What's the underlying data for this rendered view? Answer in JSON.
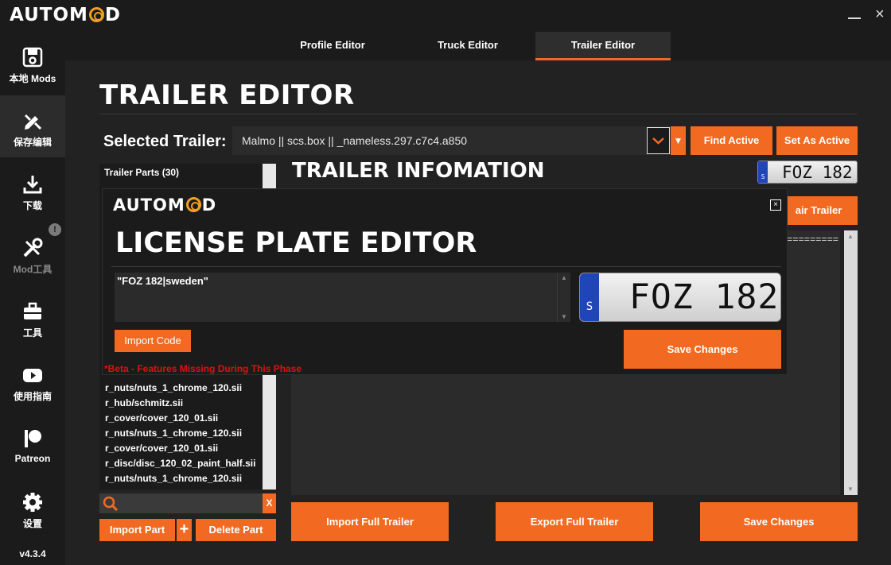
{
  "app": {
    "brand_pre": "AUTOM",
    "brand_post": "D",
    "version": "v4.3.4"
  },
  "window": {
    "minimize": "—",
    "close": "×"
  },
  "sidebar": {
    "items": [
      {
        "label": "本地 Mods",
        "icon": "floppy-disk-icon"
      },
      {
        "label": "保存编辑",
        "icon": "edit-tools-icon"
      },
      {
        "label": "下载",
        "icon": "download-icon"
      },
      {
        "label": "Mod工具",
        "icon": "wrench-screwdriver-icon"
      },
      {
        "label": "工具",
        "icon": "toolbox-icon"
      },
      {
        "label": "使用指南",
        "icon": "youtube-icon"
      },
      {
        "label": "Patreon",
        "icon": "patreon-icon"
      },
      {
        "label": "设置",
        "icon": "gear-icon"
      }
    ],
    "badge": "!"
  },
  "tabs": [
    {
      "label": "Profile Editor"
    },
    {
      "label": "Truck Editor"
    },
    {
      "label": "Trailer Editor"
    }
  ],
  "page": {
    "title": "TRAILER EDITOR",
    "selected_label": "Selected Trailer:",
    "selected_value": "Malmo || scs.box || _nameless.297.c7c4.a850",
    "find_active": "Find Active",
    "set_as_active": "Set As Active"
  },
  "parts": {
    "header": "Trailer Parts (30)",
    "items": [
      "r_nuts/nuts_1_chrome_120.sii",
      "r_hub/schmitz.sii",
      "r_cover/cover_120_01.sii",
      "r_nuts/nuts_1_chrome_120.sii",
      "r_cover/cover_120_01.sii",
      "r_disc/disc_120_02_paint_half.sii",
      "r_nuts/nuts_1_chrome_120.sii"
    ],
    "search_clear": "X",
    "import_part": "Import Part",
    "add": "+",
    "delete_part": "Delete Part"
  },
  "info": {
    "title": "TRAILER INFOMATION",
    "repair_button": "air Trailer",
    "text": "=========="
  },
  "plate": {
    "text": "FOZ 182",
    "country_code": "S"
  },
  "bottom": {
    "import_full": "Import Full Trailer",
    "export_full": "Export Full Trailer",
    "save_changes": "Save Changes"
  },
  "modal": {
    "brand_pre": "AUTOM",
    "brand_post": "D",
    "close": "×",
    "title": "LICENSE PLATE EDITOR",
    "code": "\"FOZ 182|sweden\"",
    "import_code": "Import Code",
    "save_changes": "Save Changes",
    "beta_note": "*Beta - Features Missing During This Phase"
  },
  "colors": {
    "accent": "#f26a21",
    "background": "#1b1b1b",
    "panel": "#2b2b2b",
    "beta": "#e01010"
  }
}
